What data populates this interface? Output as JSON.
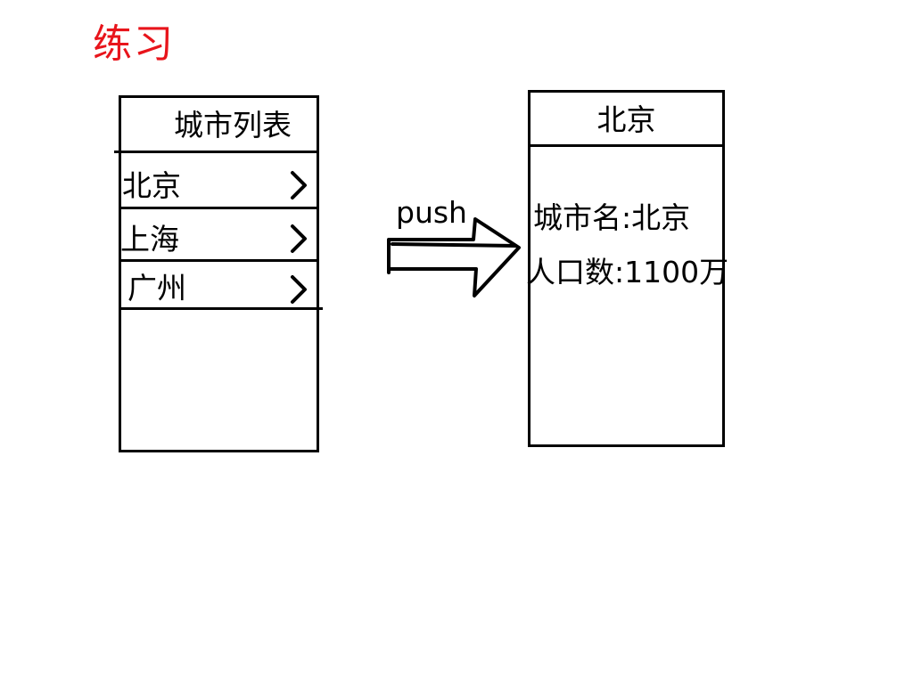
{
  "title": "练习",
  "list_screen": {
    "header": "城市列表",
    "items": [
      {
        "label": "北京",
        "chevron": "chevron-right-icon"
      },
      {
        "label": "上海",
        "chevron": "chevron-right-icon"
      },
      {
        "label": "广州",
        "chevron": "chevron-right-icon"
      }
    ]
  },
  "transition": {
    "label": "push",
    "icon": "arrow-right-icon"
  },
  "detail_screen": {
    "header": "北京",
    "city_name_line": "城市名:北京",
    "population_line": "人口数:1100万"
  },
  "colors": {
    "title": "#e8141b",
    "stroke": "#000000"
  }
}
